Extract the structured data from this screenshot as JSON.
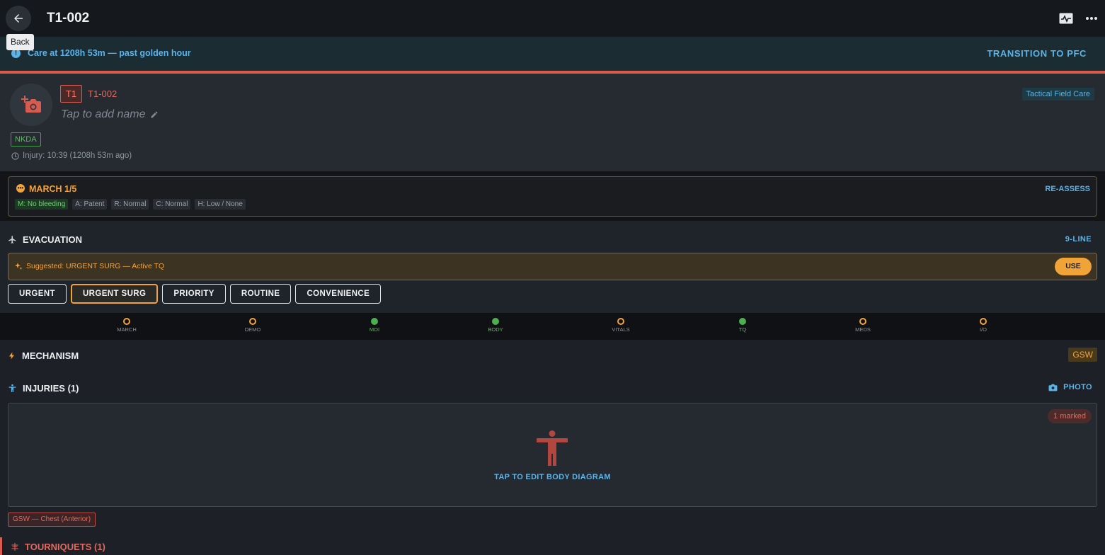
{
  "header": {
    "title": "T1-002",
    "back_tooltip": "Back",
    "icons": [
      "arrow-left-icon",
      "vitals-monitor-icon",
      "more-horizontal-icon"
    ]
  },
  "banner": {
    "message": "Care at 1208h 53m — past golden hour",
    "action": "TRANSITION TO PFC",
    "color": "#5ab4ea",
    "alert_color": "#d95b50"
  },
  "patient": {
    "triage": "T1",
    "id": "T1-002",
    "name_placeholder": "Tap to add name",
    "phase": "Tactical Field Care",
    "allergy": "NKDA",
    "injury_time": "Injury: 10:39 (1208h 53m ago)"
  },
  "march": {
    "title": "MARCH 1/5",
    "action": "RE-ASSESS",
    "chips": [
      {
        "label": "M: No bleeding",
        "status": "green"
      },
      {
        "label": "A: Patent",
        "status": "neutral"
      },
      {
        "label": "R: Normal",
        "status": "neutral"
      },
      {
        "label": "C: Normal",
        "status": "neutral"
      },
      {
        "label": "H: Low / None",
        "status": "neutral"
      }
    ]
  },
  "evacuation": {
    "title": "EVACUATION",
    "action": "9-LINE",
    "suggestion": "Suggested: URGENT SURG — Active TQ",
    "use_label": "USE",
    "priorities": [
      "URGENT",
      "URGENT SURG",
      "PRIORITY",
      "ROUTINE",
      "CONVENIENCE"
    ],
    "selected_priority": "URGENT SURG"
  },
  "steps": [
    {
      "label": "MARCH",
      "done": false
    },
    {
      "label": "DEMO",
      "done": false
    },
    {
      "label": "MOI",
      "done": true
    },
    {
      "label": "BODY",
      "done": true
    },
    {
      "label": "VITALS",
      "done": false
    },
    {
      "label": "TQ",
      "done": true
    },
    {
      "label": "MEDS",
      "done": false
    },
    {
      "label": "I/O",
      "done": false
    }
  ],
  "mechanism": {
    "title": "MECHANISM",
    "value": "GSW"
  },
  "injuries": {
    "title": "INJURIES (1)",
    "photo_label": "PHOTO",
    "marked": "1 marked",
    "edit_label": "TAP TO EDIT BODY DIAGRAM",
    "tags": [
      "GSW — Chest (Anterior)"
    ]
  },
  "tourniquets": {
    "title": "TOURNIQUETS (1)"
  }
}
